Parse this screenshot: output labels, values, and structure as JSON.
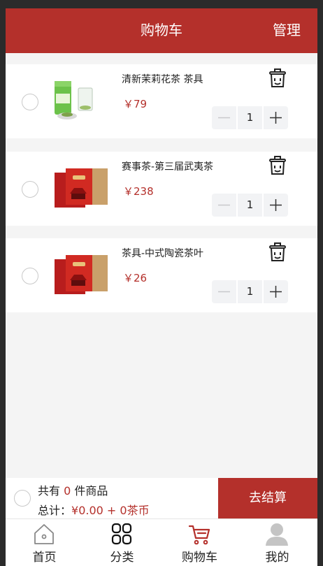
{
  "header": {
    "title": "购物车",
    "manage_label": "管理"
  },
  "items": [
    {
      "name": "清新茉莉花茶 茶具",
      "price": "￥79",
      "qty": "1",
      "image": "green-tea-can"
    },
    {
      "name": "赛事茶-第三届武夷茶",
      "price": "￥238",
      "qty": "1",
      "image": "red-gift-box"
    },
    {
      "name": "茶具-中式陶瓷茶叶",
      "price": "￥26",
      "qty": "1",
      "image": "red-gift-box"
    }
  ],
  "summary": {
    "count_prefix": "共有",
    "count_value": "0",
    "count_suffix": "件商品",
    "total_prefix": "总计：",
    "total_value": "¥0.00 + 0茶币",
    "checkout_label": "去结算"
  },
  "tabbar": [
    {
      "label": "首页",
      "icon": "home-icon"
    },
    {
      "label": "分类",
      "icon": "category-icon"
    },
    {
      "label": "购物车",
      "icon": "cart-icon"
    },
    {
      "label": "我的",
      "icon": "user-icon"
    }
  ],
  "colors": {
    "accent": "#b4302b",
    "background": "#f4f4f4"
  }
}
